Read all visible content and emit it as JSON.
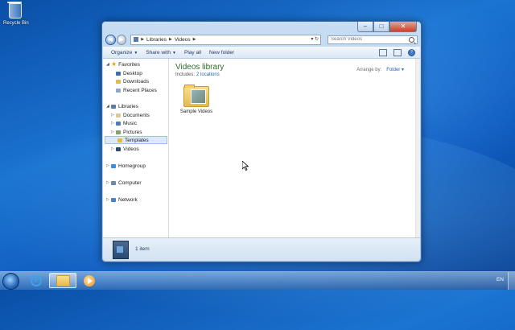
{
  "desktop": {
    "recycle_bin_label": "Recycle Bin"
  },
  "window": {
    "address": {
      "crumbs": [
        "Libraries",
        "Videos"
      ]
    },
    "search": {
      "placeholder": "Search Videos"
    },
    "toolbar": {
      "organize": "Organize",
      "share_with": "Share with",
      "play_all": "Play all",
      "new_folder": "New folder"
    },
    "nav": {
      "favorites": "Favorites",
      "desktop": "Desktop",
      "downloads": "Downloads",
      "recent_places": "Recent Places",
      "libraries": "Libraries",
      "documents": "Documents",
      "music": "Music",
      "pictures": "Pictures",
      "templates": "Templates",
      "videos": "Videos",
      "homegroup": "Homegroup",
      "computer": "Computer",
      "network": "Network"
    },
    "content": {
      "title": "Videos library",
      "includes_label": "Includes:",
      "includes_link": "2 locations",
      "arrange_label": "Arrange by:",
      "arrange_value": "Folder",
      "items": [
        {
          "label": "Sample Videos"
        }
      ]
    },
    "details": {
      "count": "1 item"
    }
  },
  "taskbar": {
    "language": "EN"
  }
}
